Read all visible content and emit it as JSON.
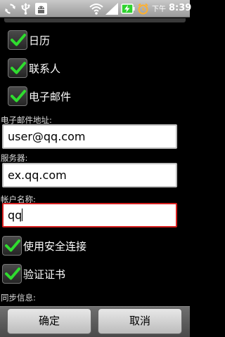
{
  "status_bar": {
    "time_prefix": "下午",
    "time": "8:39",
    "icons": [
      "sync-icon",
      "usb-icon",
      "android-debug-icon",
      "wifi-icon",
      "signal-icon",
      "battery-charging-icon",
      "alarm-icon"
    ]
  },
  "sync_options": [
    {
      "label": "日历",
      "checked": true
    },
    {
      "label": "联系人",
      "checked": true
    },
    {
      "label": "电子邮件",
      "checked": true
    }
  ],
  "form": {
    "email": {
      "label": "电子邮件地址:",
      "value": "user@qq.com"
    },
    "server": {
      "label": "服务器:",
      "value": "ex.qq.com"
    },
    "account": {
      "label": "帐户名称:",
      "value": "qq"
    }
  },
  "secure_connection": {
    "label": "使用安全连接",
    "checked": true
  },
  "verify_certificate": {
    "label": "验证证书",
    "checked": true
  },
  "sync_info_label": "同步信息:",
  "buttons": {
    "ok": "确定",
    "cancel": "取消"
  },
  "colors": {
    "check_green": "#2fdc2f",
    "focus_border": "#d62020"
  }
}
